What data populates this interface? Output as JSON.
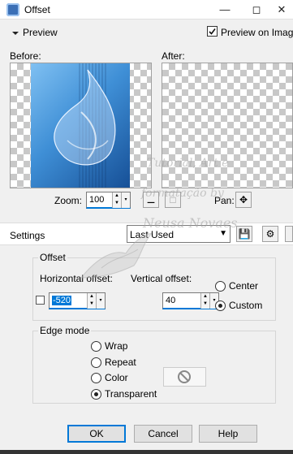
{
  "window": {
    "title": "Offset"
  },
  "preview_section": {
    "label": "Preview",
    "checkbox_label": "Preview on Image",
    "checked": true
  },
  "before_label": "Before:",
  "after_label": "After:",
  "zoom": {
    "label": "Zoom:",
    "value": "100"
  },
  "pan_label": "Pan:",
  "settings": {
    "label": "Settings",
    "preset": "Last Used"
  },
  "offset_group": {
    "title": "Offset",
    "horizontal_label": "Horizontal offset:",
    "horizontal_value": "-520",
    "vertical_label": "Vertical offset:",
    "vertical_value": "40",
    "center_label": "Center",
    "custom_label": "Custom",
    "selected": "Custom"
  },
  "edge_group": {
    "title": "Edge mode",
    "options": [
      "Wrap",
      "Repeat",
      "Color",
      "Transparent"
    ],
    "selected": "Transparent"
  },
  "buttons": {
    "ok": "OK",
    "cancel": "Cancel",
    "help": "Help"
  },
  "watermark": [
    "Tutorial, Art e",
    "formatação by",
    "Neusa Novaes"
  ],
  "colors": {
    "accent": "#0078d7",
    "preview_blue": "#3f8fd6"
  }
}
